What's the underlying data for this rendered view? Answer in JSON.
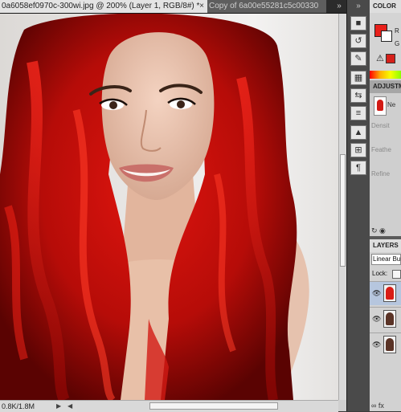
{
  "tabs": {
    "active_label": "0a6058ef0970c-300wi.jpg @ 200% (Layer 1, RGB/8#) *",
    "active_close": "×",
    "inactive_label": "Copy of 6a00e55281c5c00330",
    "overflow": "»"
  },
  "status": {
    "zoom_text": "0.8K/1.8M",
    "arrow": "▶",
    "arrow2": "◀"
  },
  "dock": {
    "collapse": "»",
    "buttons": [
      "swatch-icon",
      "history-icon",
      "brush-icon",
      "adjust-icon",
      "layers-icon",
      "paths-icon",
      "channels-icon",
      "sliders-icon",
      "text-icon"
    ],
    "glyphs": [
      "■",
      "↺",
      "✎",
      "▦",
      "⇆",
      "≡",
      "▲",
      "⊞",
      "¶"
    ]
  },
  "color_panel": {
    "tab_label": "COLOR",
    "fg_color": "#e8201a",
    "bg_color": "#ffffff",
    "channel_r": "R",
    "channel_g": "G",
    "warning_glyph": "⚠"
  },
  "adjustments_panel": {
    "tab_label": "ADJUSTM",
    "thumb_text": "Ne",
    "label_1": "Densit",
    "label_2": "Feathe",
    "label_3": "Refine",
    "bottom_glyphs": "↻ ◉"
  },
  "layers_panel": {
    "tab_label": "LAYERS",
    "blend_mode": "Linear Bur",
    "lock_label": "Lock:",
    "eye_glyph": "👁",
    "footer_glyphs": "∞ fx"
  }
}
